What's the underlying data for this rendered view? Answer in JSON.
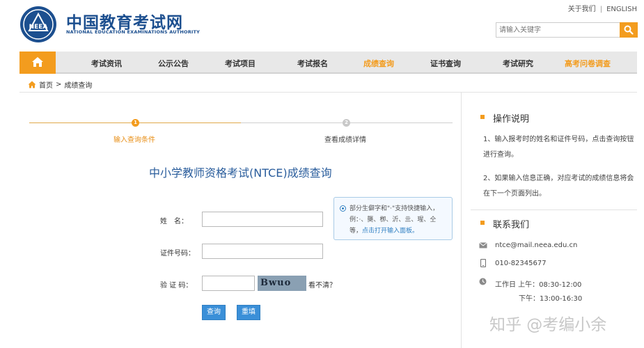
{
  "header": {
    "logo_cn": "中国教育考试网",
    "logo_en": "NATIONAL EDUCATION EXAMINATIONS AUTHORITY",
    "logo_badge": "NEEA",
    "about_link": "关于我们",
    "sep": "|",
    "english_link": "ENGLISH",
    "search_placeholder": "请输入关键字"
  },
  "nav": {
    "items": [
      "考试资讯",
      "公示公告",
      "考试项目",
      "考试报名",
      "成绩查询",
      "证书查询",
      "考试研究",
      "高考问卷调查"
    ],
    "active_index": 4
  },
  "breadcrumb": {
    "home": "首页",
    "sep": ">",
    "current": "成绩查询"
  },
  "steps": {
    "step1_num": "1",
    "step1_label": "输入查询条件",
    "step2_num": "2",
    "step2_label": "查看成绩详情"
  },
  "form": {
    "title": "中小学教师资格考试(NTCE)成绩查询",
    "name_label": "姓　名：",
    "id_label": "证件号码：",
    "captcha_label": "验 证 码：",
    "captcha_image_text": "Bwuo",
    "unclear_link": "看不清？",
    "query_button": "查询",
    "reset_button": "重填"
  },
  "hint": {
    "text": "部分生僻字和\"·\"支持快捷输入，例：·、龑、栁、沂、亖、瑆、仝等，",
    "link": "点击打开输入面板。"
  },
  "sidebar": {
    "instructions_title": "操作说明",
    "instruction_1": "1、输入报考时的姓名和证件号码，点击查询按钮进行查询。",
    "instruction_2": "2、如果输入信息正确，对应考试的成绩信息将会在下一个页面列出。",
    "contact_title": "联系我们",
    "email": "ntce@mail.neea.edu.cn",
    "phone": "010-82345677",
    "hours_weekday": "工作日 上午：08:30-12:00",
    "hours_afternoon": "下午：13:00-16:30"
  },
  "watermark": "知乎 @考编小余",
  "colors": {
    "accent": "#f39c1e",
    "brand": "#1c4f8f",
    "link": "#2f7fc2",
    "button": "#3a8fd8"
  }
}
